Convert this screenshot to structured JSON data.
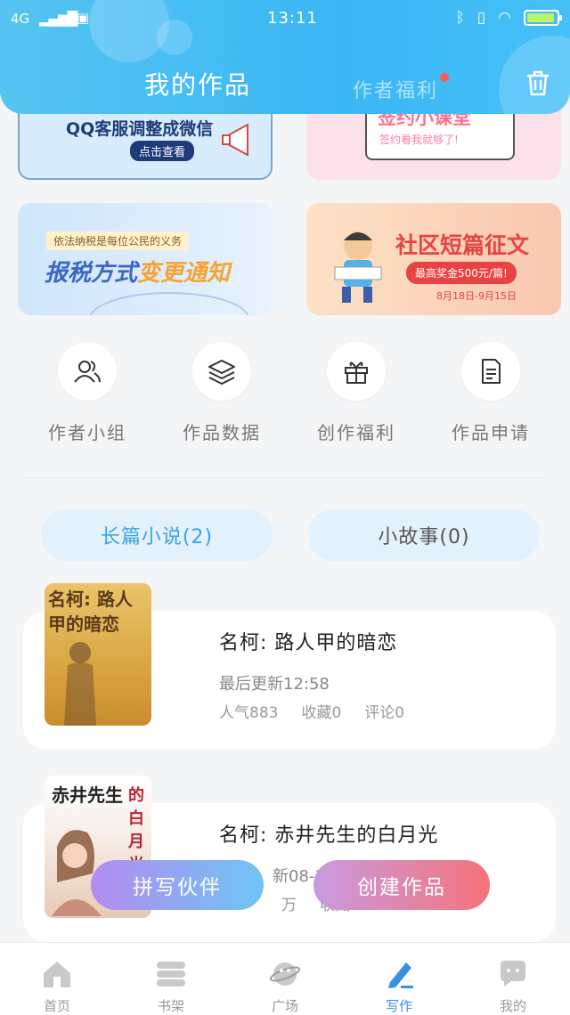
{
  "status_bar": {
    "network": "4G",
    "time": "13:11"
  },
  "header": {
    "tabs": [
      {
        "label": "我的作品",
        "active": true
      },
      {
        "label": "作者福利",
        "active": false,
        "has_dot": true
      }
    ],
    "trash_icon": "trash-icon"
  },
  "banners": [
    {
      "text": "QQ客服调整成微信",
      "button": "点击查看"
    },
    {
      "title": "签约小课堂",
      "subtitle": "签约看我就够了!"
    },
    {
      "tag": "依法纳税是每位公民的义务",
      "title_a": "报税方式",
      "title_b": "变更通知"
    },
    {
      "title": "社区短篇征文",
      "prize": "最高奖金500元/篇!",
      "date": "8月18日-9月15日"
    }
  ],
  "quick_actions": [
    {
      "label": "作者小组",
      "icon": "users-icon"
    },
    {
      "label": "作品数据",
      "icon": "layers-icon"
    },
    {
      "label": "创作福利",
      "icon": "gift-icon"
    },
    {
      "label": "作品申请",
      "icon": "document-icon"
    }
  ],
  "segments": [
    {
      "label": "长篇小说(2)",
      "active": true
    },
    {
      "label": "小故事(0)",
      "active": false
    }
  ],
  "works": [
    {
      "cover_title": "名柯: 路人甲的暗恋",
      "title": "名柯: 路人甲的暗恋",
      "updated": "最后更新12:58",
      "popularity": "人气883",
      "favorites": "收藏0",
      "comments": "评论0"
    },
    {
      "cover_title": "赤井先生",
      "cover_side": "的白月光",
      "title": "名柯: 赤井先生的白月光",
      "updated": "新08-18",
      "popularity": "万",
      "favorites": "收藏"
    }
  ],
  "floating_buttons": {
    "partner": "拼写伙伴",
    "create": "创建作品"
  },
  "bottom_nav": [
    {
      "label": "首页",
      "icon": "home-icon"
    },
    {
      "label": "书架",
      "icon": "bookshelf-icon"
    },
    {
      "label": "广场",
      "icon": "planet-icon"
    },
    {
      "label": "写作",
      "icon": "pen-icon",
      "active": true
    },
    {
      "label": "我的",
      "icon": "chat-bubble-icon"
    }
  ],
  "colors": {
    "accent": "#3ab7f5",
    "active_nav": "#3a8fe0",
    "dot": "#ff5a4a"
  }
}
